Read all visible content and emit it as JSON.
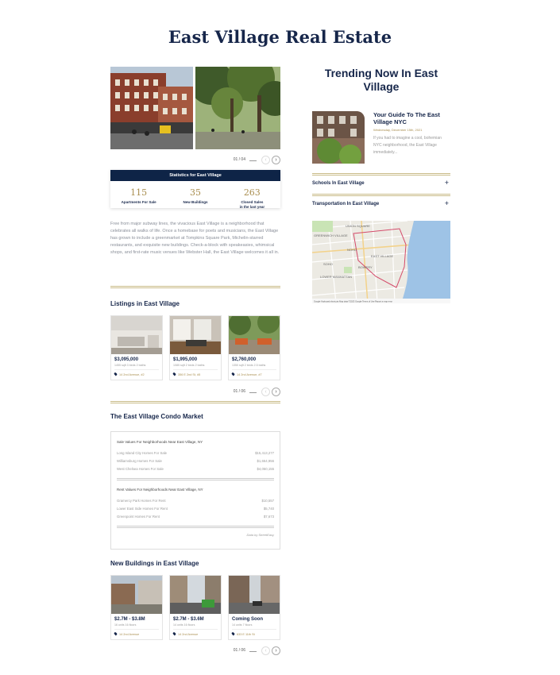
{
  "page": {
    "title": "East Village Real Estate"
  },
  "gallery": {
    "counter": "01 / 04",
    "prev_icon": "chevron-left-icon",
    "next_icon": "chevron-right-icon"
  },
  "stats": {
    "header": "Statistics for East Village",
    "items": [
      {
        "value": "115",
        "label": "Apartments For Sale",
        "label2": ""
      },
      {
        "value": "35",
        "label": "New Buildings",
        "label2": ""
      },
      {
        "value": "263",
        "label": "Closed Sales",
        "label2": "in the last year"
      }
    ]
  },
  "intro": "Free from major subway lines, the vivacious East Village is a neighborhood that celebrates all walks of life. Once a homebase for poets and musicians, the East Village has grown to include a greenmarket at Tompkins Square Park, Michelin-starred restaurants, and exquisite new buildings. Check-a-block with speakeasies, whimsical shops, and first-rate music venues like Webster Hall, the East Village welcomes it all in.",
  "listings": {
    "title": "Listings in East Village",
    "counter": "01 / 06",
    "items": [
      {
        "price": "$3,095,000",
        "meta": "1455 sqft  3 beds  2 baths",
        "address": "14 2nd Avenue, #2"
      },
      {
        "price": "$1,995,000",
        "meta": "1085 sqft  2 beds  2 baths",
        "address": "356 E 2nd St, #5"
      },
      {
        "price": "$2,760,000",
        "meta": "1350 sqft  2 beds  2.5 baths",
        "address": "14 2nd Avenue, #7"
      }
    ]
  },
  "condo": {
    "title": "The East Village Condo Market",
    "sale_heading": "Sale Values For Neighborhoods Near East Village, NY",
    "sale_rows": [
      {
        "name": "Long Island City Homes For Sale",
        "value": "$15,413,277"
      },
      {
        "name": "Williamsburg Homes For Sale",
        "value": "$1,654,956"
      },
      {
        "name": "West Chelsea Homes For Sale",
        "value": "$4,050,155"
      }
    ],
    "rent_heading": "Rent Values For Neighborhoods Near East Village, NY",
    "rent_rows": [
      {
        "name": "Gramercy Park Homes For Rent",
        "value": "$10,557"
      },
      {
        "name": "Lower East Side Homes For Rent",
        "value": "$5,740"
      },
      {
        "name": "Greenpoint Homes For Rent",
        "value": "$7,673"
      }
    ],
    "source": "Data by StreetEasy"
  },
  "new_buildings": {
    "title": "New Buildings in East Village",
    "counter": "01 / 06",
    "items": [
      {
        "price": "$2.7M - $3.8M",
        "meta": "16 units  16 floors",
        "address": "14 2nd Avenue"
      },
      {
        "price": "$2.7M - $3.6M",
        "meta": "14 units  16 floors",
        "address": "14 2nd Avenue"
      },
      {
        "price": "Coming Soon",
        "meta": "14 units  7 floors",
        "address": "633 E 11th St"
      }
    ]
  },
  "trending": {
    "title": "Trending Now In East Village",
    "guide_title": "Your Guide To The East Village NYC",
    "guide_date": "Wednesday, December 15th, 2021",
    "guide_desc": "If you had to imagine a cool, bohemian NYC neighborhood, the East Village immediately...",
    "accordions": [
      {
        "label": "Schools In East Village",
        "icon": "plus-icon"
      },
      {
        "label": "Transportation In East Village",
        "icon": "plus-icon"
      }
    ]
  },
  "map": {
    "labels": [
      "UNION SQUARE",
      "GREENWICH VILLAGE",
      "NOHO",
      "EAST VILLAGE",
      "LOWER MANHATTAN",
      "SOHO",
      "BOWERY"
    ],
    "footer": "Google  Keyboard shortcuts  Map data ©2023 Google  Terms of Use  Report a map error"
  }
}
